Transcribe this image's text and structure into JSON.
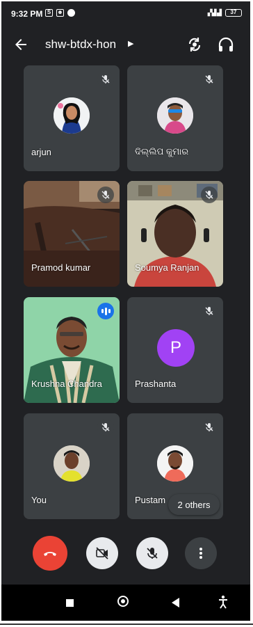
{
  "status_bar": {
    "time": "9:32 PM",
    "battery": "37"
  },
  "header": {
    "meeting_code": "shw-btdx-hon"
  },
  "participants": [
    {
      "name": "arjun",
      "muted": true
    },
    {
      "name": "ଦିଲ୍ଲିପ କୁମାର",
      "muted": true
    },
    {
      "name": "Pramod kumar",
      "muted": true
    },
    {
      "name": "Soumya Ranjan",
      "muted": true
    },
    {
      "name": "Krushna Chandra",
      "muted": false,
      "speaking": true
    },
    {
      "name": "Prashanta",
      "muted": true,
      "avatar_letter": "P"
    },
    {
      "name": "You",
      "muted": true
    },
    {
      "name": "Pustam",
      "muted": true
    }
  ],
  "others_chip": "2 others",
  "colors": {
    "background": "#202124",
    "tile": "#3c4043",
    "end_call": "#ea4335",
    "speaking": "#1a73e8",
    "letter_avatar": "#a142f4"
  },
  "icons": [
    "back-arrow-icon",
    "flip-camera-icon",
    "headphones-icon",
    "mic-off-icon",
    "speaking-indicator-icon",
    "end-call-icon",
    "camera-off-icon",
    "more-options-icon"
  ]
}
